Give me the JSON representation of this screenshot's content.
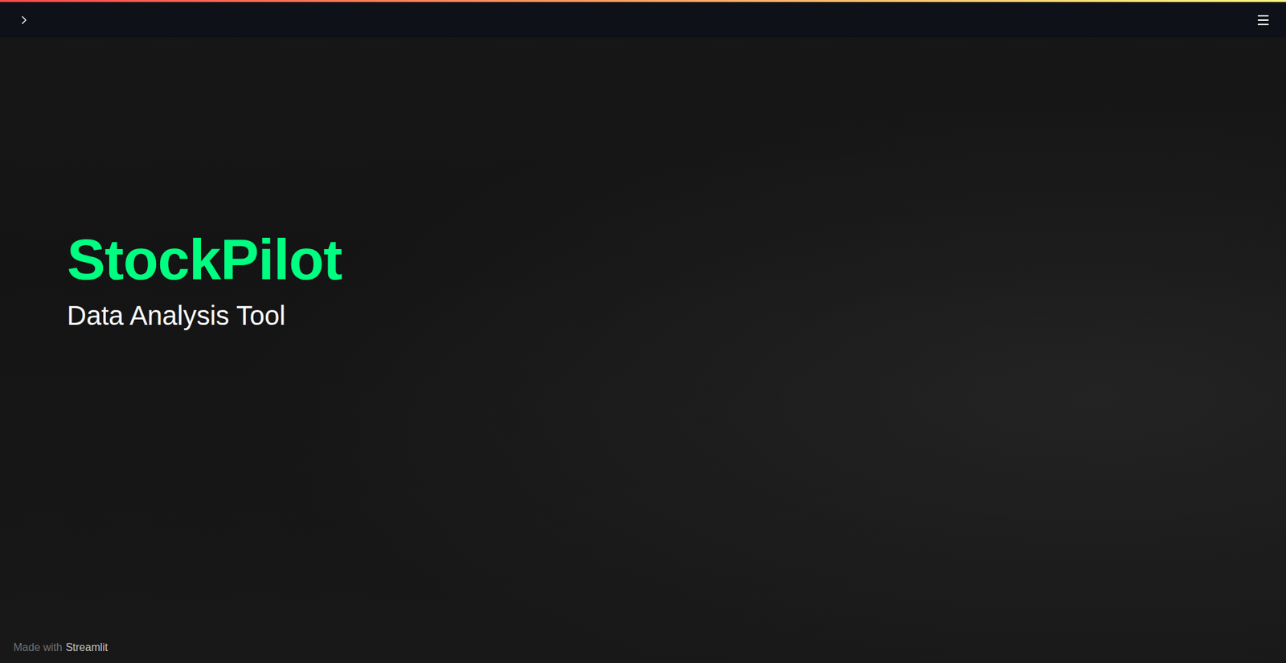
{
  "app": {
    "title": "StockPilot",
    "subtitle": "Data Analysis Tool"
  },
  "footer": {
    "prefix": "Made with",
    "link": "Streamlit"
  }
}
